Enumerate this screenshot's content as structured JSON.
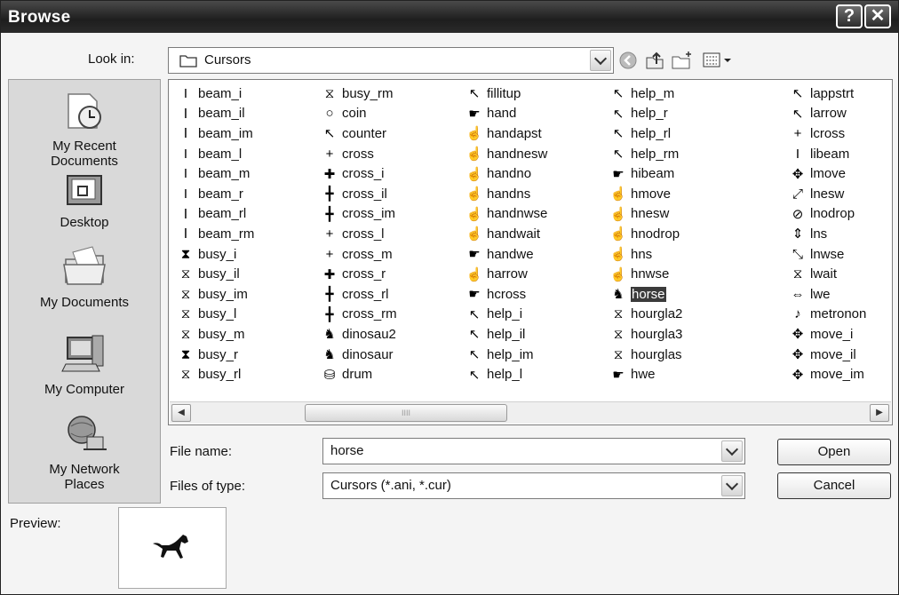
{
  "window": {
    "title": "Browse",
    "help_glyph": "?",
    "close_glyph": "✕"
  },
  "lookin": {
    "label": "Look in:",
    "value": "Cursors",
    "folder_icon": "folder-icon"
  },
  "toolbar": {
    "icons": [
      "back-icon",
      "up-folder-icon",
      "new-folder-icon",
      "view-menu-icon"
    ]
  },
  "places": [
    {
      "label": "My Recent\nDocuments",
      "icon": "recent-documents-icon"
    },
    {
      "label": "Desktop",
      "icon": "desktop-icon"
    },
    {
      "label": "My Documents",
      "icon": "my-documents-icon"
    },
    {
      "label": "My Computer",
      "icon": "my-computer-icon"
    },
    {
      "label": "My Network\nPlaces",
      "icon": "network-places-icon"
    }
  ],
  "files": {
    "columns": [
      [
        {
          "name": "beam_i",
          "glyph": "I"
        },
        {
          "name": "beam_il",
          "glyph": "Ⅰ"
        },
        {
          "name": "beam_im",
          "glyph": "Ⅰ"
        },
        {
          "name": "beam_l",
          "glyph": "I"
        },
        {
          "name": "beam_m",
          "glyph": "I"
        },
        {
          "name": "beam_r",
          "glyph": "I"
        },
        {
          "name": "beam_rl",
          "glyph": "Ⅰ"
        },
        {
          "name": "beam_rm",
          "glyph": "Ⅰ"
        },
        {
          "name": "busy_i",
          "glyph": "⧗"
        },
        {
          "name": "busy_il",
          "glyph": "⧖"
        },
        {
          "name": "busy_im",
          "glyph": "⧖"
        },
        {
          "name": "busy_l",
          "glyph": "⧖"
        },
        {
          "name": "busy_m",
          "glyph": "⧖"
        },
        {
          "name": "busy_r",
          "glyph": "⧗"
        },
        {
          "name": "busy_rl",
          "glyph": "⧖"
        }
      ],
      [
        {
          "name": "busy_rm",
          "glyph": "⧖"
        },
        {
          "name": "coin",
          "glyph": "○"
        },
        {
          "name": "counter",
          "glyph": "↖"
        },
        {
          "name": "cross",
          "glyph": "+"
        },
        {
          "name": "cross_i",
          "glyph": "✚"
        },
        {
          "name": "cross_il",
          "glyph": "╋"
        },
        {
          "name": "cross_im",
          "glyph": "╋"
        },
        {
          "name": "cross_l",
          "glyph": "+"
        },
        {
          "name": "cross_m",
          "glyph": "+"
        },
        {
          "name": "cross_r",
          "glyph": "✚"
        },
        {
          "name": "cross_rl",
          "glyph": "╋"
        },
        {
          "name": "cross_rm",
          "glyph": "╋"
        },
        {
          "name": "dinosau2",
          "glyph": "♞"
        },
        {
          "name": "dinosaur",
          "glyph": "♞"
        },
        {
          "name": "drum",
          "glyph": "⛁"
        }
      ],
      [
        {
          "name": "fillitup",
          "glyph": "↖"
        },
        {
          "name": "hand",
          "glyph": "☛"
        },
        {
          "name": "handapst",
          "glyph": "☝"
        },
        {
          "name": "handnesw",
          "glyph": "☝"
        },
        {
          "name": "handno",
          "glyph": "☝"
        },
        {
          "name": "handns",
          "glyph": "☝"
        },
        {
          "name": "handnwse",
          "glyph": "☝"
        },
        {
          "name": "handwait",
          "glyph": "☝"
        },
        {
          "name": "handwe",
          "glyph": "☛"
        },
        {
          "name": "harrow",
          "glyph": "☝"
        },
        {
          "name": "hcross",
          "glyph": "☛"
        },
        {
          "name": "help_i",
          "glyph": "↖"
        },
        {
          "name": "help_il",
          "glyph": "↖"
        },
        {
          "name": "help_im",
          "glyph": "↖"
        },
        {
          "name": "help_l",
          "glyph": "↖"
        }
      ],
      [
        {
          "name": "help_m",
          "glyph": "↖"
        },
        {
          "name": "help_r",
          "glyph": "↖"
        },
        {
          "name": "help_rl",
          "glyph": "↖"
        },
        {
          "name": "help_rm",
          "glyph": "↖"
        },
        {
          "name": "hibeam",
          "glyph": "☛"
        },
        {
          "name": "hmove",
          "glyph": "☝"
        },
        {
          "name": "hnesw",
          "glyph": "☝"
        },
        {
          "name": "hnodrop",
          "glyph": "☝"
        },
        {
          "name": "hns",
          "glyph": "☝"
        },
        {
          "name": "hnwse",
          "glyph": "☝"
        },
        {
          "name": "horse",
          "glyph": "♞",
          "selected": true
        },
        {
          "name": "hourgla2",
          "glyph": "⧖"
        },
        {
          "name": "hourgla3",
          "glyph": "⧖"
        },
        {
          "name": "hourglas",
          "glyph": "⧖"
        },
        {
          "name": "hwe",
          "glyph": "☛"
        }
      ],
      [
        {
          "name": "lappstrt",
          "glyph": "↖"
        },
        {
          "name": "larrow",
          "glyph": "↖"
        },
        {
          "name": "lcross",
          "glyph": "+"
        },
        {
          "name": "libeam",
          "glyph": "I"
        },
        {
          "name": "lmove",
          "glyph": "✥"
        },
        {
          "name": "lnesw",
          "glyph": "⤢"
        },
        {
          "name": "lnodrop",
          "glyph": "⊘"
        },
        {
          "name": "lns",
          "glyph": "⇕"
        },
        {
          "name": "lnwse",
          "glyph": "⤡"
        },
        {
          "name": "lwait",
          "glyph": "⧖"
        },
        {
          "name": "lwe",
          "glyph": "⇔"
        },
        {
          "name": "metronon",
          "glyph": "♪"
        },
        {
          "name": "move_i",
          "glyph": "✥"
        },
        {
          "name": "move_il",
          "glyph": "✥"
        },
        {
          "name": "move_im",
          "glyph": "✥"
        }
      ]
    ]
  },
  "scrollbar": {
    "left_glyph": "◀",
    "right_glyph": "▶",
    "grip": "IIII"
  },
  "filename": {
    "label": "File name:",
    "value": "horse"
  },
  "filetype": {
    "label": "Files of type:",
    "value": "Cursors (*.ani, *.cur)"
  },
  "buttons": {
    "open": "Open",
    "cancel": "Cancel"
  },
  "preview": {
    "label": "Preview:",
    "icon": "horse-cursor-icon"
  }
}
